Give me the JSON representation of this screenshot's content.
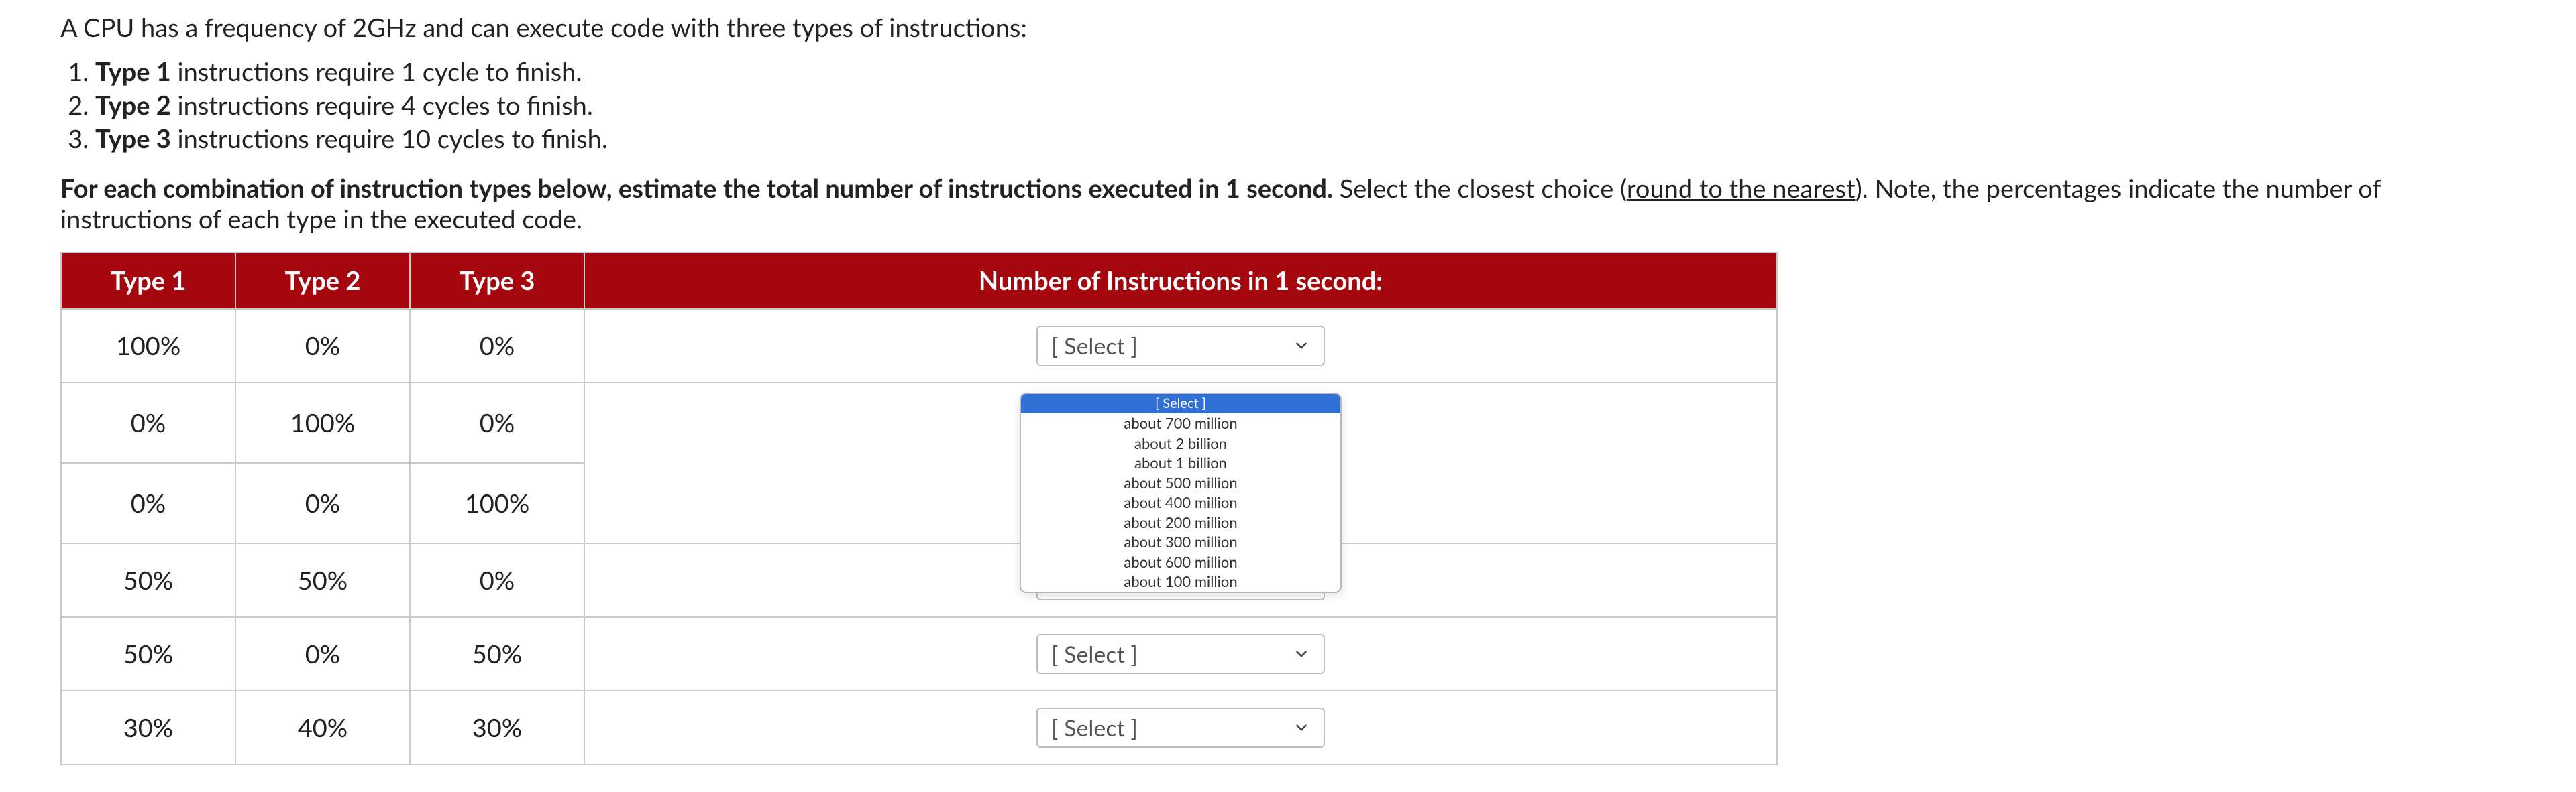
{
  "intro": "A CPU has a frequency of 2GHz and can execute code with three types of instructions:",
  "types": [
    {
      "label": "Type 1",
      "desc": " instructions require 1 cycle to finish."
    },
    {
      "label": "Type 2",
      "desc": " instructions require 4 cycles to finish."
    },
    {
      "label": "Type 3",
      "desc": " instructions require 10 cycles to finish."
    }
  ],
  "prompt": {
    "bold": "For each combination of instruction types below, estimate the total number of instructions executed in 1 second.",
    "rest_a": " Select the closest choice (",
    "underline": "round to the nearest",
    "rest_b": "). Note, the percentages indicate the number of instructions of each type in the executed code."
  },
  "headers": {
    "t1": "Type 1",
    "t2": "Type 2",
    "t3": "Type 3",
    "answer": "Number of Instructions in 1 second:"
  },
  "rows": [
    {
      "t1": "100%",
      "t2": "0%",
      "t3": "0%"
    },
    {
      "t1": "0%",
      "t2": "100%",
      "t3": "0%"
    },
    {
      "t1": "0%",
      "t2": "0%",
      "t3": "100%"
    },
    {
      "t1": "50%",
      "t2": "50%",
      "t3": "0%"
    },
    {
      "t1": "50%",
      "t2": "0%",
      "t3": "50%"
    },
    {
      "t1": "30%",
      "t2": "40%",
      "t3": "30%"
    }
  ],
  "select_placeholder": "[ Select ]",
  "dropdown": {
    "header": "[ Select ]",
    "options": [
      "about 700 million",
      "about 2 billion",
      "about 1 billion",
      "about 500 million",
      "about 400 million",
      "about 200 million",
      "about 300 million",
      "about 600 million",
      "about 100 million"
    ]
  }
}
